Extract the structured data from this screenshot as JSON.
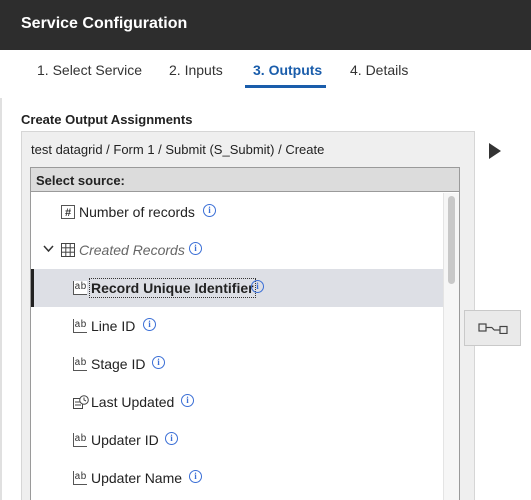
{
  "window": {
    "title": "Service Configuration"
  },
  "tabs": [
    {
      "label": "1. Select Service"
    },
    {
      "label": "2. Inputs"
    },
    {
      "label": "3. Outputs",
      "active": true
    },
    {
      "label": "4. Details"
    }
  ],
  "main": {
    "section_title": "Create Output Assignments",
    "breadcrumb": "test datagrid / Form 1 / Submit (S_Submit) / Create",
    "source_header": "Select source:",
    "tree": [
      {
        "label": "Number of records",
        "icon": "hash-icon",
        "info": "i"
      },
      {
        "label": "Created Records",
        "icon": "table-icon",
        "expanded": true,
        "info": "i"
      },
      {
        "label": "Record Unique Identifier",
        "icon": "text-field-icon",
        "icon_text": "ab",
        "selected": true,
        "info": "i"
      },
      {
        "label": "Line ID",
        "icon": "text-field-icon",
        "icon_text": "ab",
        "info": "i"
      },
      {
        "label": "Stage ID",
        "icon": "text-field-icon",
        "icon_text": "ab",
        "info": "i"
      },
      {
        "label": "Last Updated",
        "icon": "datetime-field-icon",
        "info": "i"
      },
      {
        "label": "Updater ID",
        "icon": "text-field-icon",
        "icon_text": "ab",
        "info": "i"
      },
      {
        "label": "Updater Name",
        "icon": "text-field-icon",
        "icon_text": "ab",
        "info": "i"
      }
    ]
  },
  "colors": {
    "titlebar_bg": "#2d2d2d",
    "accent": "#1a5dab",
    "info_icon": "#3b6fd6",
    "selected_row_bg": "#dddfe5"
  }
}
